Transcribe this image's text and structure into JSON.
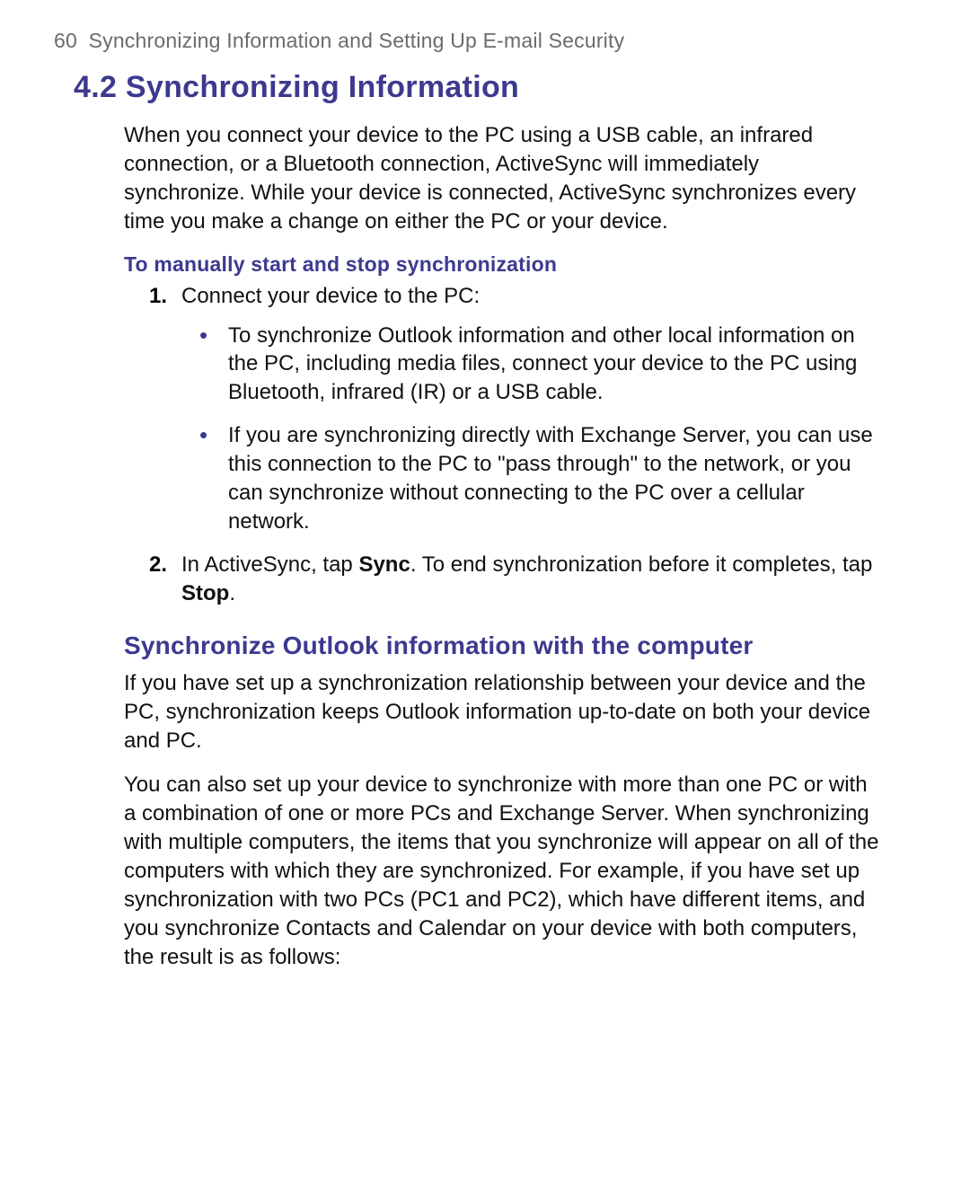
{
  "header": {
    "page_number": "60",
    "running_title": "Synchronizing Information and Setting Up E-mail Security"
  },
  "section": {
    "number": "4.2",
    "title": "Synchronizing Information",
    "intro": "When you connect your device to the PC using a USB cable, an infrared connection, or a Bluetooth connection, ActiveSync will immediately synchronize. While your device is connected, ActiveSync synchronizes every time you make a change on either the PC or your device.",
    "manual": {
      "heading": "To manually start and stop synchronization",
      "step1_text": "Connect your device to the PC:",
      "step1_bullets": [
        "To synchronize Outlook information and other local information on the PC, including media files, connect your device to the PC using Bluetooth, infrared (IR) or a USB cable.",
        "If you are synchronizing directly with Exchange Server, you can use this connection to the PC to \"pass through\" to the network, or you can synchronize without connecting to the PC over a cellular network."
      ],
      "step2_pre": "In ActiveSync, tap ",
      "step2_b1": "Sync",
      "step2_mid": ". To end synchronization before it completes, tap ",
      "step2_b2": "Stop",
      "step2_post": "."
    },
    "outlook": {
      "heading": "Synchronize Outlook information with the computer",
      "para1": "If you have set up a synchronization relationship between your device and the PC, synchronization keeps Outlook information up-to-date on both your device and PC.",
      "para2": "You can also set up your device to synchronize with more than one PC or with a combination of one or more PCs and Exchange Server. When synchronizing with multiple computers, the items that you synchronize will appear on all of the computers with which they are synchronized. For example, if you have set up synchronization with two PCs (PC1 and PC2), which have different items, and you synchronize Contacts and Calendar on your device with both computers, the result is as follows:"
    }
  }
}
